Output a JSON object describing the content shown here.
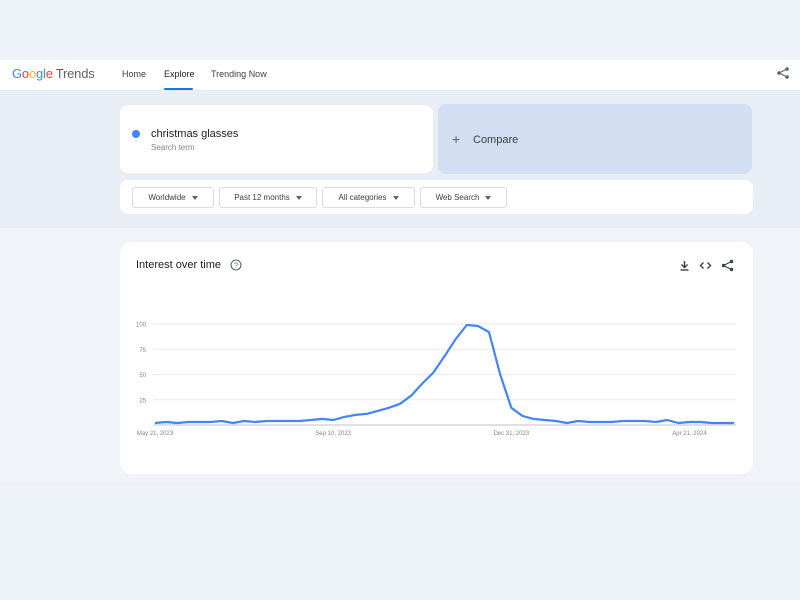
{
  "header": {
    "logo": {
      "google": [
        "G",
        "o",
        "o",
        "g",
        "l",
        "e"
      ],
      "product": "Trends"
    },
    "nav": [
      "Home",
      "Explore",
      "Trending Now"
    ],
    "share_icon": "share-icon"
  },
  "search": {
    "term": "christmas glasses",
    "term_type": "Search term",
    "term_color": "#4285f4",
    "compare_label": "Compare"
  },
  "filters": [
    "Worldwide",
    "Past 12 months",
    "All categories",
    "Web Search"
  ],
  "chart_card": {
    "title": "Interest over time",
    "icons": [
      "help-icon",
      "download-icon",
      "embed-icon",
      "share-icon"
    ]
  },
  "chart_data": {
    "type": "line",
    "title": "",
    "xlabel": "",
    "ylabel": "",
    "ylim": [
      0,
      100
    ],
    "y_ticks": [
      25,
      50,
      75,
      100
    ],
    "x_tick_labels": [
      "May 21, 2023",
      "Sep 10, 2023",
      "Dec 31, 2023",
      "Apr 21, 2024"
    ],
    "x_tick_weeks": [
      0,
      16,
      32,
      48
    ],
    "grid": true,
    "line_color": "#4285f4",
    "series": [
      {
        "values": [
          2,
          3,
          2,
          3,
          3,
          3,
          4,
          2,
          4,
          3,
          4,
          4,
          4,
          4,
          5,
          6,
          5,
          8,
          10,
          11,
          14,
          17,
          21,
          29,
          41,
          52,
          68,
          85,
          99,
          98,
          92,
          50,
          17,
          9,
          6,
          5,
          4,
          2,
          4,
          3,
          3,
          3,
          4,
          4,
          4,
          3,
          5,
          2,
          3,
          3,
          2,
          2,
          2
        ]
      }
    ]
  }
}
